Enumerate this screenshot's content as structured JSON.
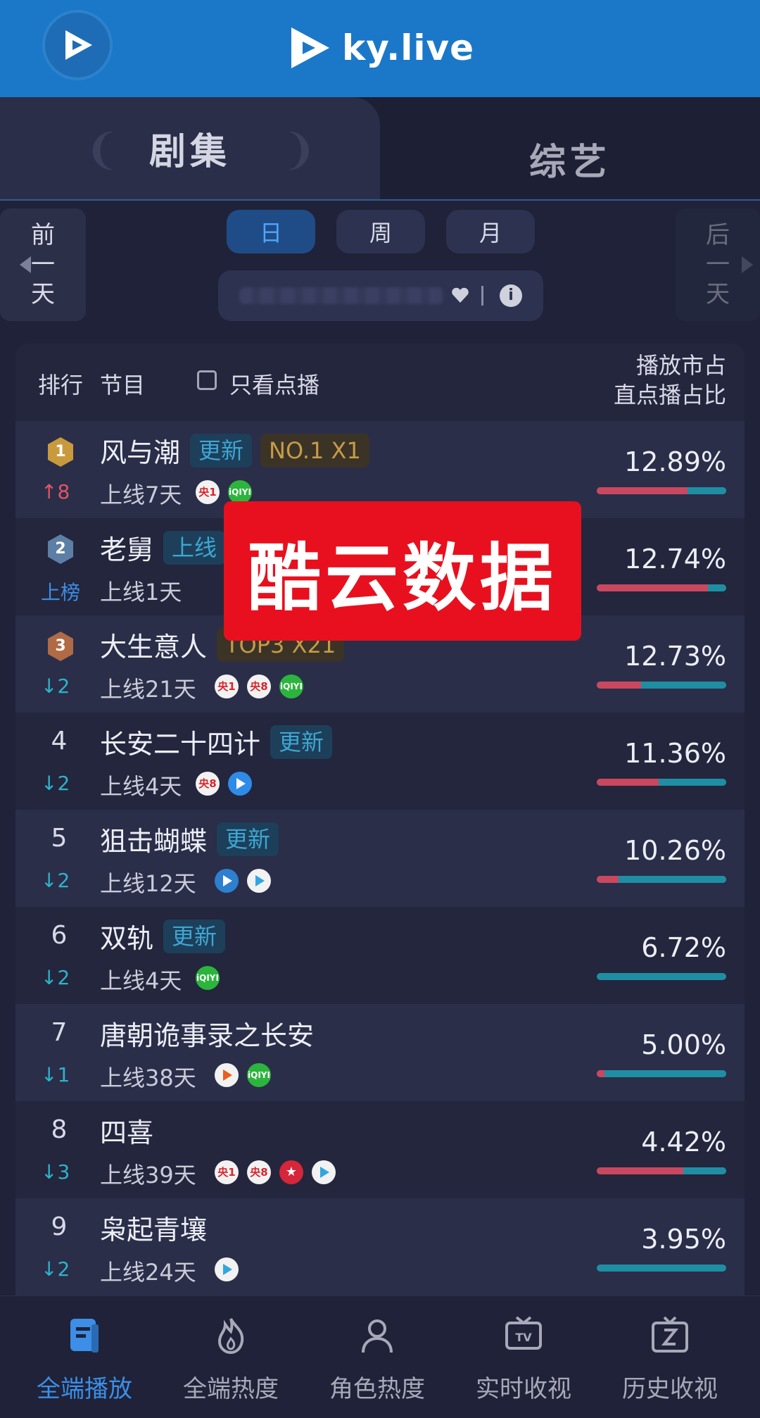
{
  "header": {
    "brand": "ky.live"
  },
  "tabs": {
    "drama": "剧集",
    "variety": "综艺"
  },
  "period": {
    "prev": [
      "前",
      "一",
      "天"
    ],
    "next": [
      "后",
      "一",
      "天"
    ],
    "buttons": [
      "日",
      "周",
      "月"
    ],
    "active": "日"
  },
  "table": {
    "header": {
      "rank": "排行",
      "program": "节目",
      "vod_only": "只看点播",
      "share_line1": "播放市占",
      "share_line2": "直点播占比"
    },
    "rows": [
      {
        "rank": "1",
        "change": "↑8",
        "change_dir": "up",
        "title": "风与潮",
        "tags": [
          {
            "text": "更新",
            "type": "update"
          },
          {
            "text": "NO.1 X1",
            "type": "rank"
          }
        ],
        "days": "上线7天",
        "platforms": [
          {
            "icon": "cctv1-icon",
            "text": "央1"
          },
          {
            "icon": "iqiyi-icon",
            "text": "iQIYI"
          }
        ],
        "share": "12.89%",
        "live_ratio": 0.7
      },
      {
        "rank": "2",
        "change": "上榜",
        "change_dir": "new",
        "title": "老舅",
        "tags": [
          {
            "text": "上线",
            "type": "update"
          }
        ],
        "days": "上线1天",
        "platforms": [],
        "share": "12.74%",
        "live_ratio": 0.86
      },
      {
        "rank": "3",
        "change": "↓2",
        "change_dir": "down",
        "title": "大生意人",
        "tags": [
          {
            "text": "TOP3 X21",
            "type": "rank"
          }
        ],
        "days": "上线21天",
        "platforms": [
          {
            "icon": "cctv1-icon",
            "text": "央1"
          },
          {
            "icon": "cctv8-icon",
            "text": "央8"
          },
          {
            "icon": "iqiyi-icon",
            "text": "iQIYI"
          }
        ],
        "share": "12.73%",
        "live_ratio": 0.34
      },
      {
        "rank": "4",
        "change": "↓2",
        "change_dir": "down",
        "title": "长安二十四计",
        "tags": [
          {
            "text": "更新",
            "type": "update"
          }
        ],
        "days": "上线4天",
        "platforms": [
          {
            "icon": "cctv8-icon",
            "text": "央8"
          },
          {
            "icon": "youku-icon",
            "text": ""
          }
        ],
        "share": "11.36%",
        "live_ratio": 0.48
      },
      {
        "rank": "5",
        "change": "↓2",
        "change_dir": "down",
        "title": "狙击蝴蝶",
        "tags": [
          {
            "text": "更新",
            "type": "update"
          }
        ],
        "days": "上线12天",
        "platforms": [
          {
            "icon": "zhejiang-tv-icon",
            "text": ""
          },
          {
            "icon": "tencent-video-icon",
            "text": ""
          }
        ],
        "share": "10.26%",
        "live_ratio": 0.17
      },
      {
        "rank": "6",
        "change": "↓2",
        "change_dir": "down",
        "title": "双轨",
        "tags": [
          {
            "text": "更新",
            "type": "update"
          }
        ],
        "days": "上线4天",
        "platforms": [
          {
            "icon": "iqiyi-icon",
            "text": "iQIYI"
          }
        ],
        "share": "6.72%",
        "live_ratio": 0.0
      },
      {
        "rank": "7",
        "change": "↓1",
        "change_dir": "down",
        "title": "唐朝诡事录之长安",
        "tags": [],
        "days": "上线38天",
        "platforms": [
          {
            "icon": "mango-tv-icon",
            "text": ""
          },
          {
            "icon": "iqiyi-icon",
            "text": "iQIYI"
          }
        ],
        "share": "5.00%",
        "live_ratio": 0.06
      },
      {
        "rank": "8",
        "change": "↓3",
        "change_dir": "down",
        "title": "四喜",
        "tags": [],
        "days": "上线39天",
        "platforms": [
          {
            "icon": "cctv1-icon",
            "text": "央1"
          },
          {
            "icon": "cctv8-icon",
            "text": "央8"
          },
          {
            "icon": "dragon-tv-icon",
            "text": "★"
          },
          {
            "icon": "tencent-video-icon",
            "text": ""
          }
        ],
        "share": "4.42%",
        "live_ratio": 0.67
      },
      {
        "rank": "9",
        "change": "↓2",
        "change_dir": "down",
        "title": "枭起青壤",
        "tags": [],
        "days": "上线24天",
        "platforms": [
          {
            "icon": "tencent-video-icon",
            "text": ""
          }
        ],
        "share": "3.95%",
        "live_ratio": 0.0
      }
    ]
  },
  "stamp": "酷云数据",
  "nav": [
    {
      "label": "全端播放",
      "icon": "play-list-icon",
      "active": true
    },
    {
      "label": "全端热度",
      "icon": "flame-icon",
      "active": false
    },
    {
      "label": "角色热度",
      "icon": "person-icon",
      "active": false
    },
    {
      "label": "实时收视",
      "icon": "tv-icon",
      "active": false
    },
    {
      "label": "历史收视",
      "icon": "history-tv-icon",
      "active": false
    }
  ],
  "colors": {
    "header": "#1b78c8",
    "live_bar": "#c9485f",
    "vod_bar": "#1f8ea3",
    "accent": "#3c8ee6",
    "stamp": "#e8101e"
  }
}
